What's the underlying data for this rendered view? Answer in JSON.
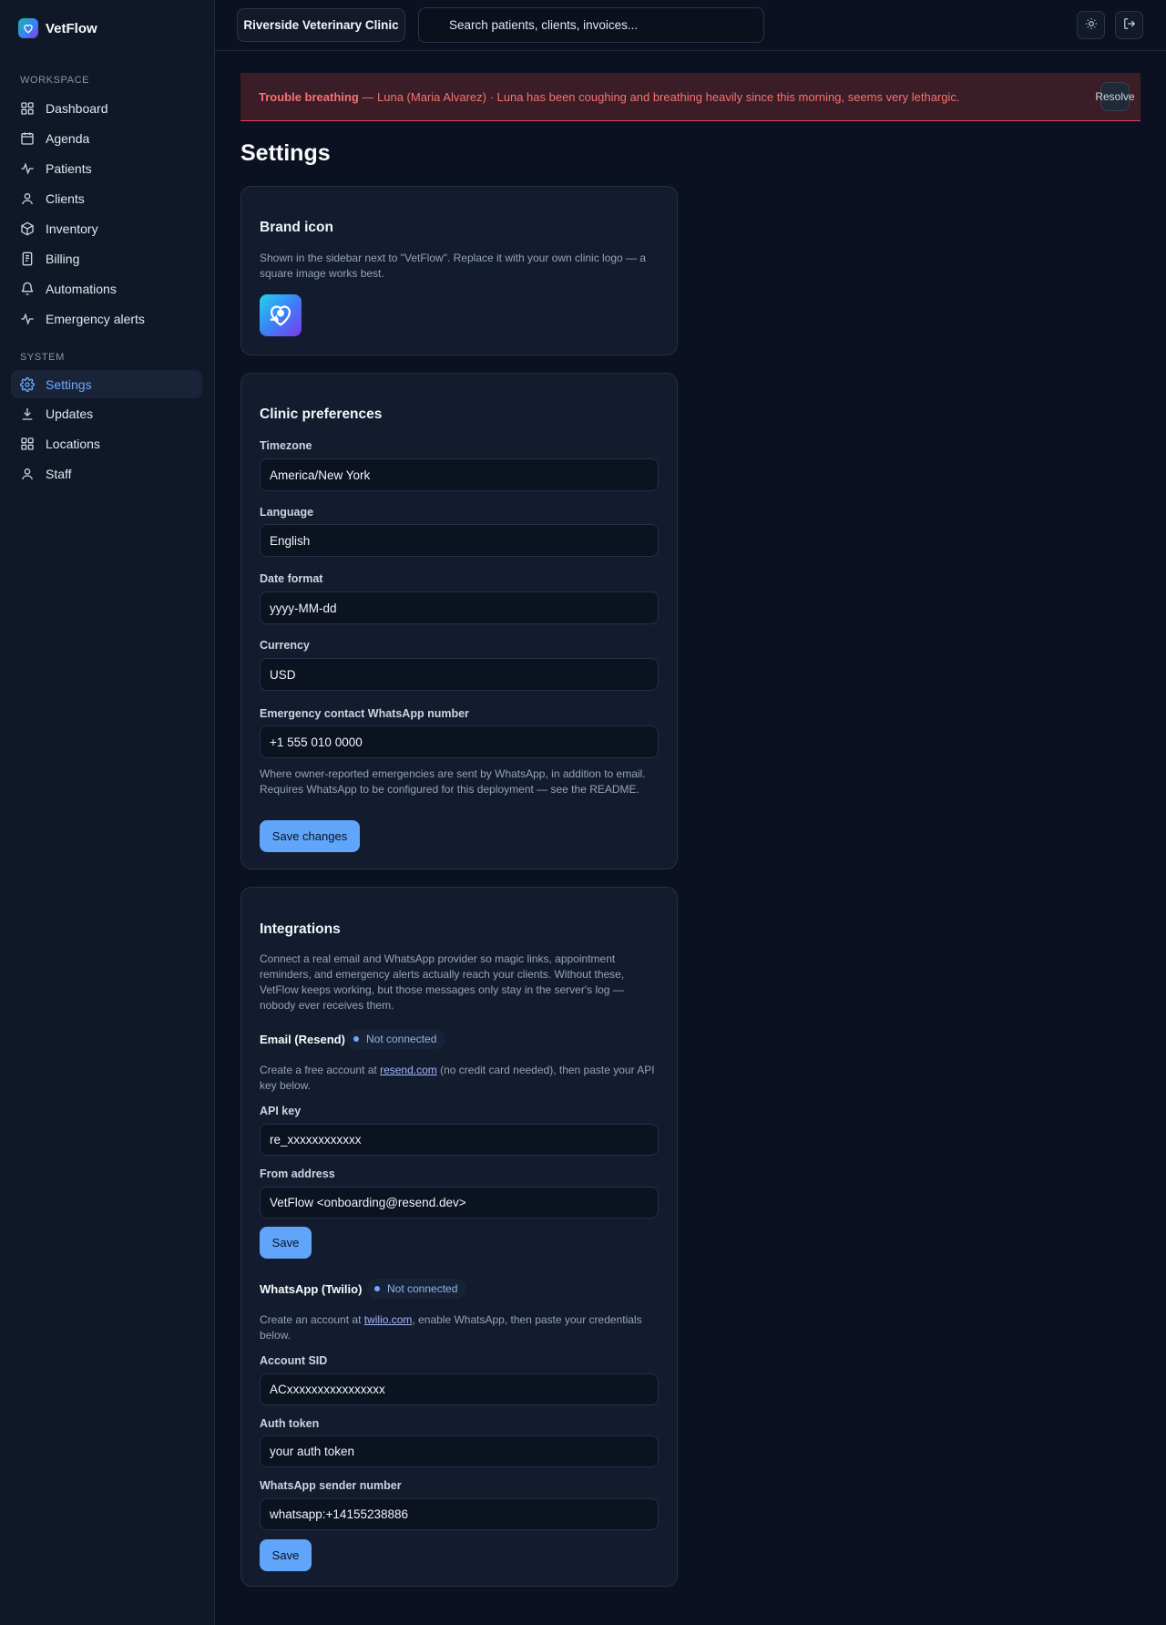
{
  "app": {
    "name": "VetFlow"
  },
  "sidebar": {
    "workspace_label": "WORKSPACE",
    "system_label": "SYSTEM",
    "workspace_items": [
      {
        "label": "Dashboard",
        "icon": "grid-icon"
      },
      {
        "label": "Agenda",
        "icon": "calendar-icon"
      },
      {
        "label": "Patients",
        "icon": "activity-icon"
      },
      {
        "label": "Clients",
        "icon": "user-icon"
      },
      {
        "label": "Inventory",
        "icon": "box-icon"
      },
      {
        "label": "Billing",
        "icon": "file-icon"
      },
      {
        "label": "Automations",
        "icon": "bell-icon"
      },
      {
        "label": "Emergency alerts",
        "icon": "activity-icon"
      }
    ],
    "system_items": [
      {
        "label": "Settings",
        "icon": "gear-icon",
        "active": true
      },
      {
        "label": "Updates",
        "icon": "download-icon"
      },
      {
        "label": "Locations",
        "icon": "grid-icon"
      },
      {
        "label": "Staff",
        "icon": "user-icon"
      }
    ]
  },
  "topbar": {
    "clinic": "Riverside Veterinary Clinic",
    "search_placeholder": "Search patients, clients, invoices..."
  },
  "alert": {
    "title": "Trouble breathing",
    "message": " — Luna (Maria Alvarez) · Luna has been coughing and breathing heavily since this morning, seems very lethargic.",
    "action": "Resolve"
  },
  "page": {
    "title": "Settings"
  },
  "brand_card": {
    "title": "Brand icon",
    "description": "Shown in the sidebar next to \"VetFlow\". Replace it with your own clinic logo — a square image works best."
  },
  "preferences": {
    "title": "Clinic preferences",
    "timezone_label": "Timezone",
    "timezone_value": "America/New York",
    "language_label": "Language",
    "language_value": "English",
    "date_format_label": "Date format",
    "date_format_value": "yyyy-MM-dd",
    "currency_label": "Currency",
    "currency_value": "USD",
    "whatsapp_label": "Emergency contact WhatsApp number",
    "whatsapp_value": "+1 555 010 0000",
    "whatsapp_help": "Where owner-reported emergencies are sent by WhatsApp, in addition to email. Requires WhatsApp to be configured for this deployment — see the README.",
    "save_label": "Save changes"
  },
  "integrations": {
    "title": "Integrations",
    "description": "Connect a real email and WhatsApp provider so magic links, appointment reminders, and emergency alerts actually reach your clients. Without these, VetFlow keeps working, but those messages only stay in the server's log — nobody ever receives them.",
    "email": {
      "title": "Email (Resend)",
      "status": "Not connected",
      "help_prefix": "Create a free account at ",
      "help_link": "resend.com",
      "help_suffix": " (no credit card needed), then paste your API key below.",
      "api_key_label": "API key",
      "api_key_value": "re_xxxxxxxxxxxx",
      "from_label": "From address",
      "from_value": "VetFlow <onboarding@resend.dev>",
      "save_label": "Save"
    },
    "whatsapp": {
      "title": "WhatsApp (Twilio)",
      "status": "Not connected",
      "help_prefix": "Create an account at ",
      "help_link": "twilio.com",
      "help_suffix": ", enable WhatsApp, then paste your credentials below.",
      "sid_label": "Account SID",
      "sid_value": "ACxxxxxxxxxxxxxxxx",
      "token_label": "Auth token",
      "token_value": "your auth token",
      "sender_label": "WhatsApp sender number",
      "sender_value": "whatsapp:+14155238886",
      "save_label": "Save"
    }
  }
}
